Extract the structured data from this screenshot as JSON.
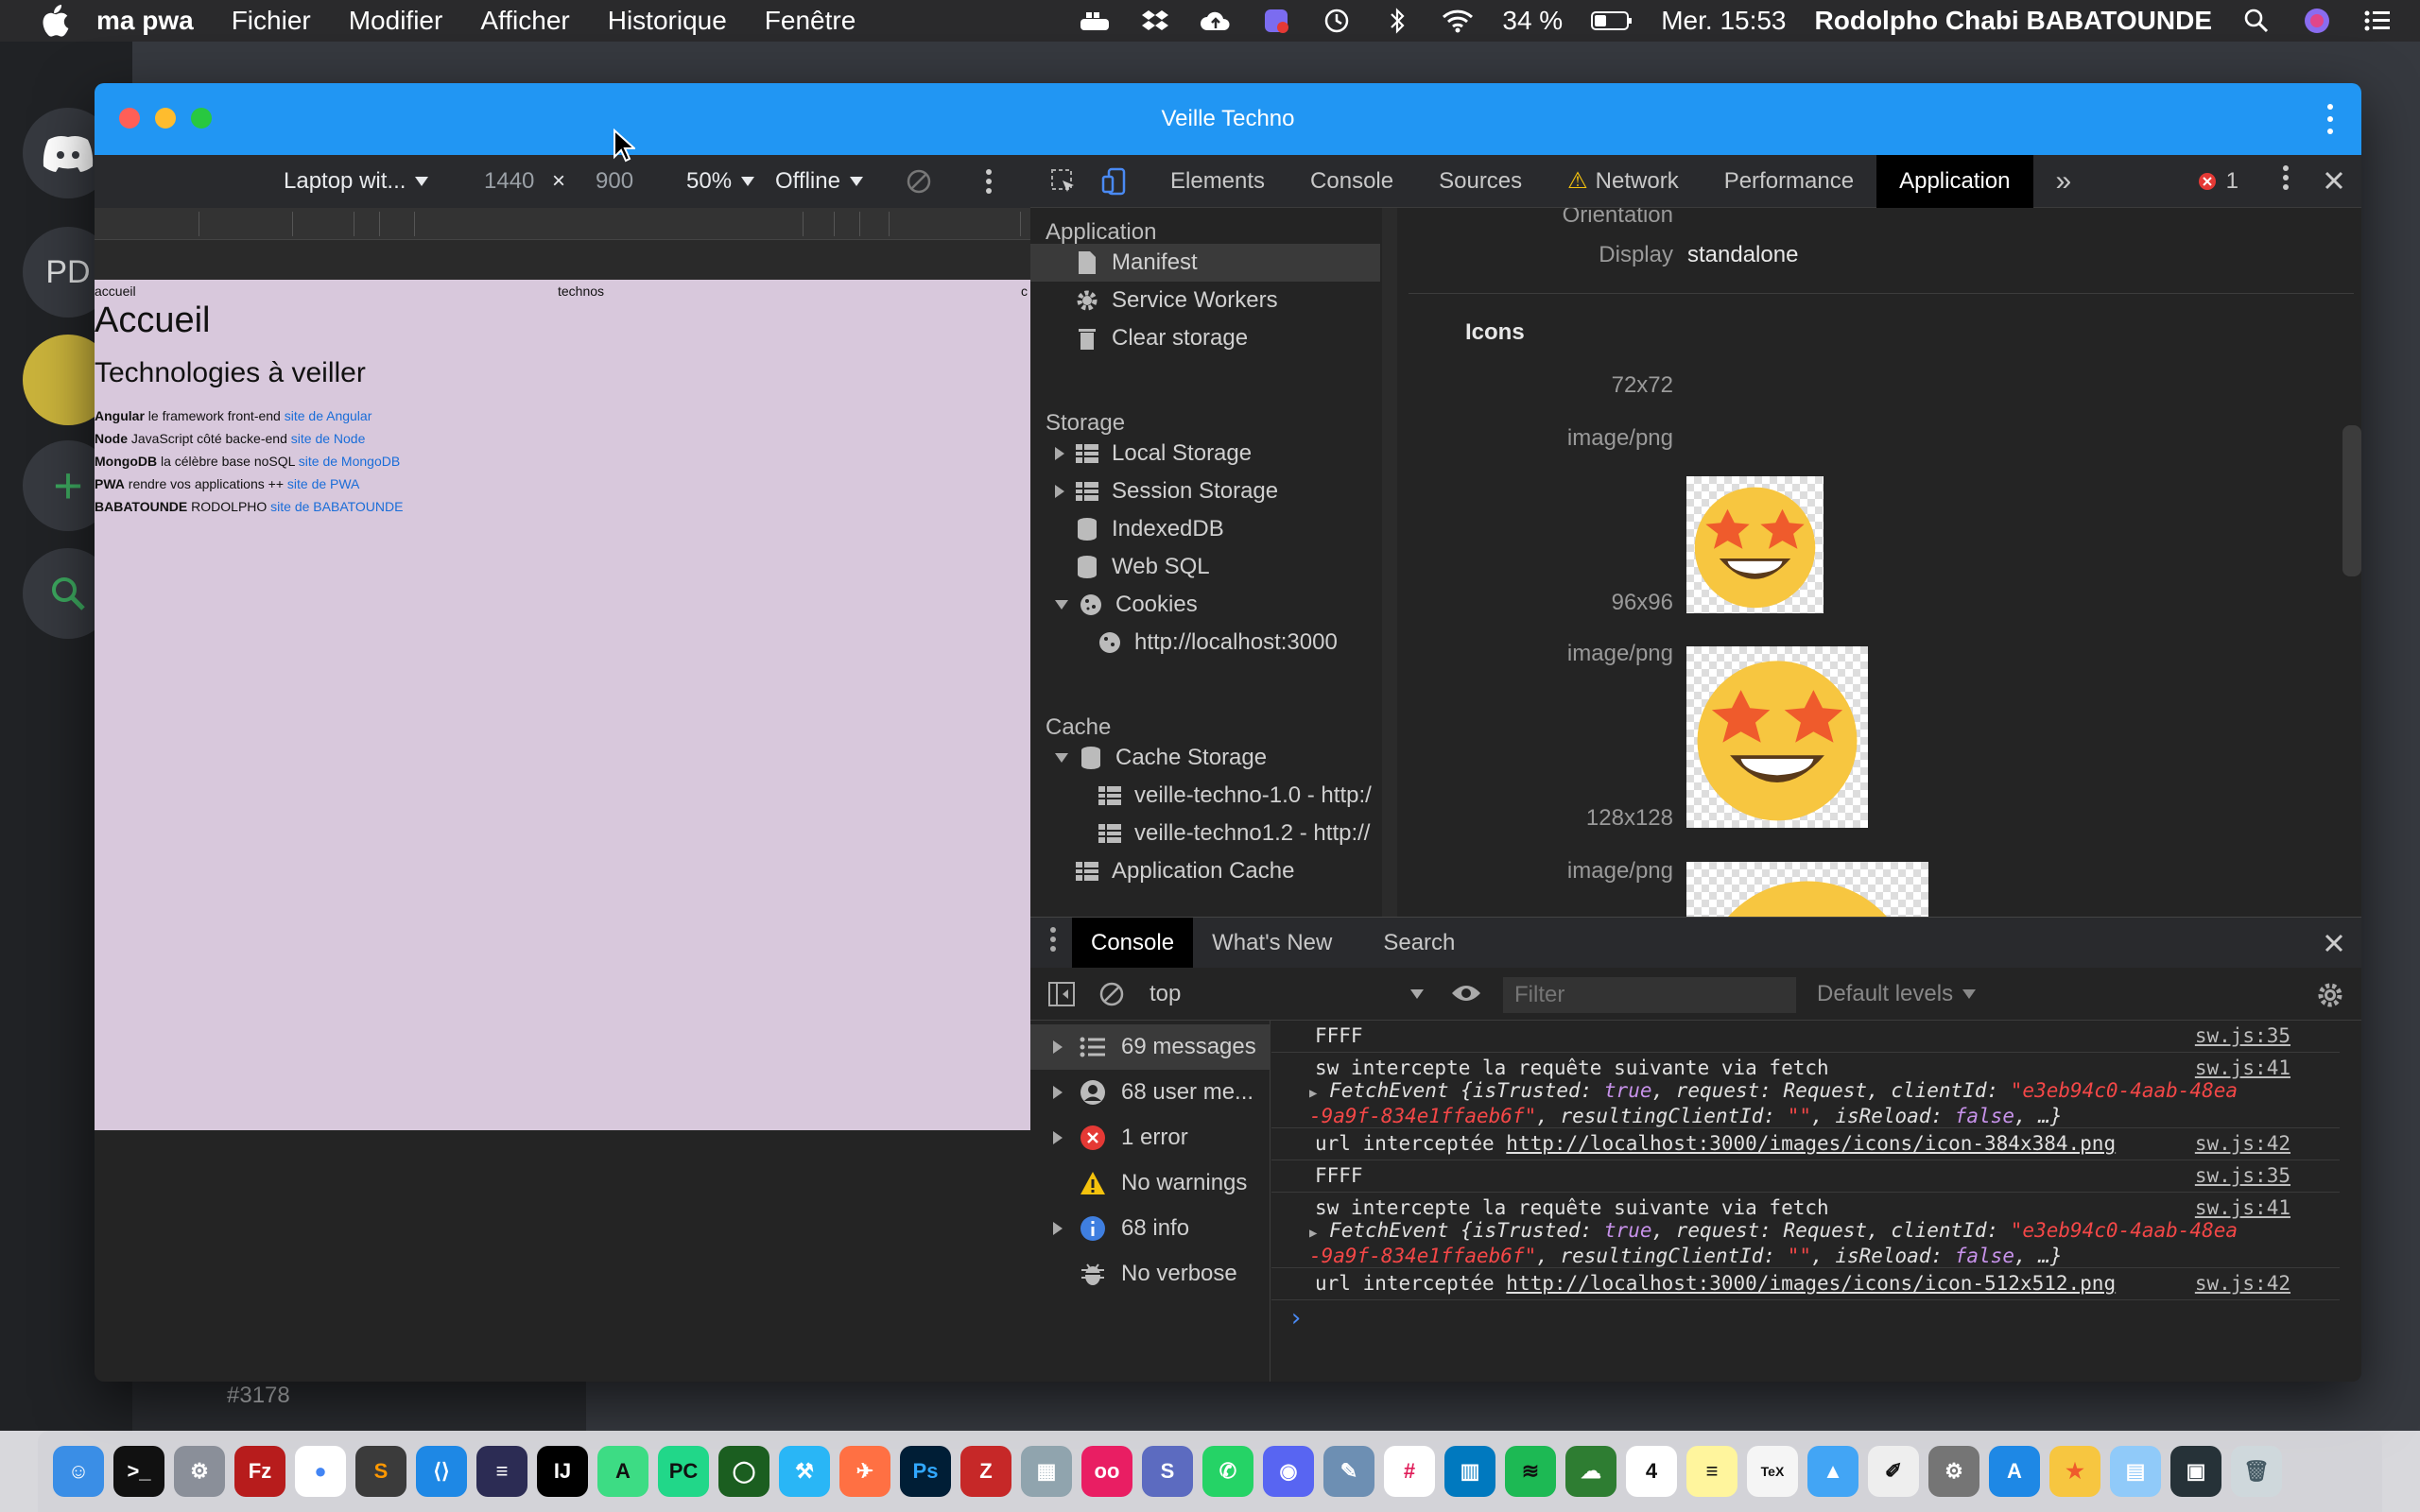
{
  "menubar": {
    "app_name": "ma pwa",
    "items": [
      "Fichier",
      "Modifier",
      "Afficher",
      "Historique",
      "Fenêtre"
    ],
    "battery": "34 %",
    "clock": "Mer. 15:53",
    "user": "Rodolpho Chabi BABATOUNDE"
  },
  "background": {
    "server_initials": "PD",
    "channel_hash": "#3178"
  },
  "window": {
    "title": "Veille Techno"
  },
  "device_toolbar": {
    "device": "Laptop wit...",
    "width": "1440",
    "times": "×",
    "height": "900",
    "zoom": "50%",
    "network": "Offline"
  },
  "page": {
    "nav": [
      "accueil",
      "technos",
      "c"
    ],
    "h1": "Accueil",
    "h2": "Technologies à veiller",
    "items": [
      {
        "name": "Angular",
        "desc": " le framework front-end ",
        "link": "site de Angular"
      },
      {
        "name": "Node",
        "desc": " JavaScript côté backe-end ",
        "link": "site de Node"
      },
      {
        "name": "MongoDB",
        "desc": " la célèbre base noSQL ",
        "link": "site de MongoDB"
      },
      {
        "name": "PWA",
        "desc": " rendre vos applications ++ ",
        "link": "site de PWA"
      },
      {
        "name": "BABATOUNDE",
        "desc": " RODOLPHO ",
        "link": "site de BABATOUNDE"
      }
    ]
  },
  "devtools_tabs": [
    "Elements",
    "Console",
    "Sources",
    "Network",
    "Performance",
    "Application"
  ],
  "devtools_more": "»",
  "error_count": "1",
  "app_sidebar": {
    "section_application": "Application",
    "manifest": "Manifest",
    "service_workers": "Service Workers",
    "clear_storage": "Clear storage",
    "section_storage": "Storage",
    "local_storage": "Local Storage",
    "session_storage": "Session Storage",
    "indexeddb": "IndexedDB",
    "websql": "Web SQL",
    "cookies": "Cookies",
    "cookie_origin": "http://localhost:3000",
    "section_cache": "Cache",
    "cache_storage": "Cache Storage",
    "cache_1": "veille-techno-1.0 - http:/",
    "cache_2": "veille-techno1.2 - http://",
    "app_cache": "Application Cache"
  },
  "manifest": {
    "orientation_label": "Orientation",
    "display_label": "Display",
    "display_value": "standalone",
    "icons_heading": "Icons",
    "icons": [
      {
        "size": "72x72",
        "type": "image/png"
      },
      {
        "size": "96x96",
        "type": "image/png"
      },
      {
        "size": "128x128",
        "type": "image/png"
      }
    ]
  },
  "drawer": {
    "tabs": [
      "Console",
      "What's New",
      "Search"
    ],
    "context": "top",
    "filter_placeholder": "Filter",
    "levels": "Default levels"
  },
  "console_sidebar": {
    "messages": "69 messages",
    "user_messages": "68 user me...",
    "errors": "1 error",
    "warnings": "No warnings",
    "info": "68 info",
    "verbose": "No verbose"
  },
  "console_messages": {
    "m1": {
      "text": "FFFF",
      "src": "sw.js:35"
    },
    "m2": {
      "text": "sw intercepte la requête suivante via fetch",
      "src": "sw.js:41",
      "obj_a": "FetchEvent {",
      "obj_b": "isTrusted",
      "obj_c": ": ",
      "obj_d": "true",
      "obj_e": ", request: Request, clientId: ",
      "obj_f": "\"e3eb94c0-4aab-48ea",
      "obj_g": "-9a9f-834e1ffaeb6f\"",
      "obj_h": ", resultingClientId: ",
      "obj_i": "\"\"",
      "obj_j": ", isReload: ",
      "obj_k": "false",
      "obj_l": ", …}"
    },
    "m3": {
      "text": "url interceptée ",
      "url": "http://localhost:3000/images/icons/icon-384x384.png",
      "src": "sw.js:42"
    },
    "m4": {
      "text": "FFFF",
      "src": "sw.js:35"
    },
    "m5": {
      "text": "sw intercepte la requête suivante via fetch",
      "src": "sw.js:41"
    },
    "m6": {
      "text": "url interceptée ",
      "url": "http://localhost:3000/images/icons/icon-512x512.png",
      "src": "sw.js:42"
    }
  },
  "console_prompt": "›",
  "colors": {
    "titlebar": "#2196f3",
    "page_bg": "#d8c8dc",
    "link": "#1a6dd8",
    "error": "#e53935",
    "warning": "#f4c20d",
    "info": "#3f7fe0"
  }
}
